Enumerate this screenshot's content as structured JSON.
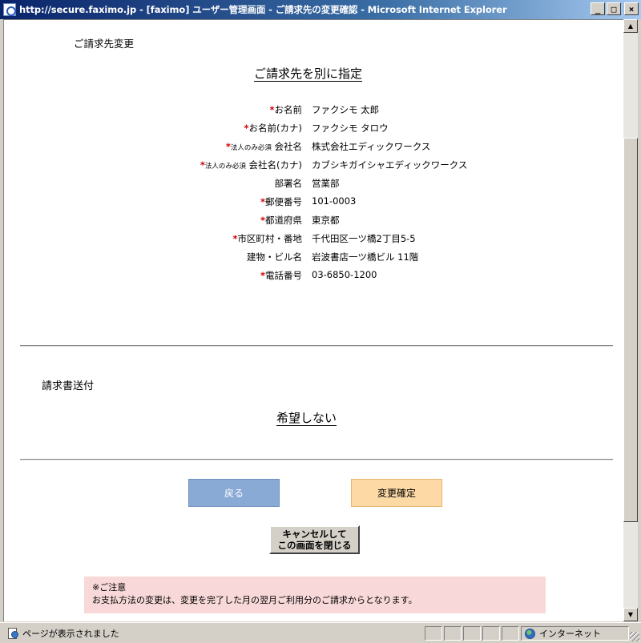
{
  "window": {
    "title": "http://secure.faximo.jp - [faximo] ユーザー管理画面 - ご請求先の変更確認 - Microsoft Internet Explorer",
    "min_label": "_",
    "max_label": "□",
    "close_label": "×"
  },
  "billing_change": {
    "section_title": "ご請求先変更",
    "heading": "ご請求先を別に指定",
    "required_mark": "*",
    "corp_only_note": "法人のみ必須",
    "fields": [
      {
        "label": "お名前",
        "value": "ファクシモ 太郎"
      },
      {
        "label": "お名前(カナ)",
        "value": "ファクシモ タロウ"
      },
      {
        "label": "会社名",
        "value": "株式会社エディックワークス"
      },
      {
        "label": "会社名(カナ)",
        "value": "カブシキガイシャエディックワークス"
      },
      {
        "label": "部署名",
        "value": "営業部"
      },
      {
        "label": "郵便番号",
        "value": "101-0003"
      },
      {
        "label": "都道府県",
        "value": "東京都"
      },
      {
        "label": "市区町村・番地",
        "value": "千代田区一ツ橋2丁目5-5"
      },
      {
        "label": "建物・ビル名",
        "value": "岩波書店一ツ橋ビル 11階"
      },
      {
        "label": "電話番号",
        "value": "03-6850-1200"
      }
    ]
  },
  "invoice_delivery": {
    "section_title": "請求書送付",
    "value": "希望しない"
  },
  "buttons": {
    "back": "戻る",
    "confirm": "変更確定",
    "cancel_line1": "キャンセルして",
    "cancel_line2": "この画面を閉じる"
  },
  "notice": {
    "title": "※ご注意",
    "text": "お支払方法の変更は、変更を完了した月の翌月ご利用分のご請求からとなります。"
  },
  "statusbar": {
    "text": "ページが表示されました",
    "zone": "インターネット"
  }
}
